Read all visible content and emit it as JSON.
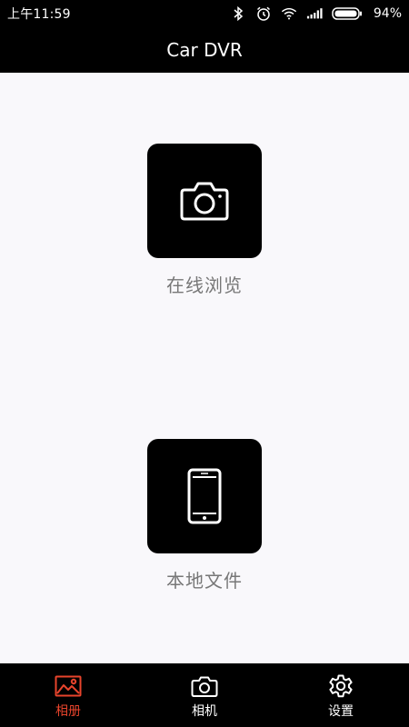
{
  "status_bar": {
    "time": "上午11:59",
    "battery_percent": "94%",
    "icons": [
      "bluetooth-icon",
      "alarm-icon",
      "wifi-icon",
      "signal-icon",
      "battery-icon"
    ]
  },
  "header": {
    "title": "Car DVR"
  },
  "main": {
    "features": [
      {
        "label": "在线浏览",
        "icon": "camera-icon"
      },
      {
        "label": "本地文件",
        "icon": "phone-icon"
      }
    ]
  },
  "bottom_nav": {
    "items": [
      {
        "label": "相册",
        "icon": "album-icon",
        "active": true
      },
      {
        "label": "相机",
        "icon": "camera-icon",
        "active": false
      },
      {
        "label": "设置",
        "icon": "gear-icon",
        "active": false
      }
    ]
  },
  "colors": {
    "accent": "#e8442c",
    "content_background": "#f9f8fb",
    "tile_background": "#000000",
    "label_gray": "#777777"
  }
}
